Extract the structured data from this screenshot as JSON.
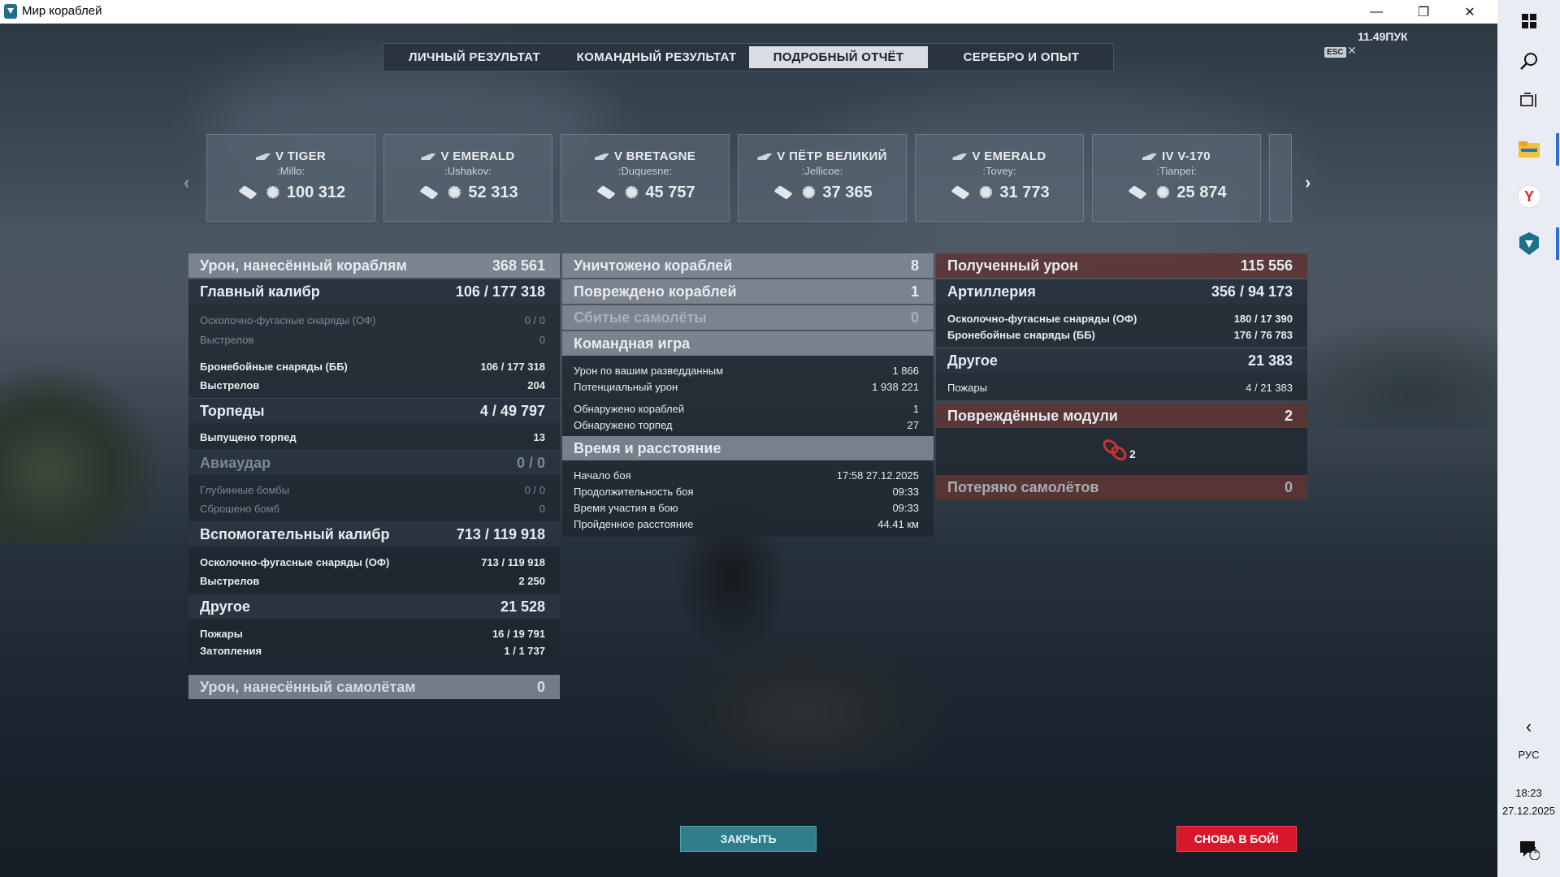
{
  "window": {
    "title": "Мир кораблей",
    "controls": {
      "minimize": "—",
      "maximize": "❐",
      "close": "✕"
    }
  },
  "tabs": [
    {
      "label": "ЛИЧНЫЙ РЕЗУЛЬТАТ",
      "active": false
    },
    {
      "label": "КОМАНДНЫЙ РЕЗУЛЬТАТ",
      "active": false
    },
    {
      "label": "ПОДРОБНЫЙ ОТЧЁТ",
      "active": true
    },
    {
      "label": "СЕРЕБРО И ОПЫТ",
      "active": false
    }
  ],
  "hud": {
    "fps": "11.49ПУК",
    "esc": "ESC",
    "esc_close": "✕"
  },
  "carousel": {
    "prev": "‹",
    "next": "›",
    "cards": [
      {
        "tier_name": "V TIGER",
        "player": ":Millo:",
        "damage": "100 312"
      },
      {
        "tier_name": "V EMERALD",
        "player": ":Ushakov:",
        "damage": "52 313"
      },
      {
        "tier_name": "V BRETAGNE",
        "player": ":Duquesne:",
        "damage": "45 757"
      },
      {
        "tier_name": "V ПЁТР ВЕЛИКИЙ",
        "player": ":Jellicoe:",
        "damage": "37 365"
      },
      {
        "tier_name": "V EMERALD",
        "player": ":Tovey:",
        "damage": "31 773"
      },
      {
        "tier_name": "IV V-170",
        "player": ":Tianpei:",
        "damage": "25 874"
      }
    ]
  },
  "left": {
    "damage_header": {
      "label": "Урон, нанесённый кораблям",
      "value": "368 561"
    },
    "main": {
      "label": "Главный калибр",
      "value": "106 / 177 318"
    },
    "main_he": {
      "label": "Осколочно-фугасные снаряды (ОФ)",
      "value": "0 / 0"
    },
    "main_he_shots": {
      "label": "Выстрелов",
      "value": "0"
    },
    "main_ap": {
      "label": "Бронебойные снаряды (ББ)",
      "value": "106 / 177 318"
    },
    "main_ap_shots": {
      "label": "Выстрелов",
      "value": "204"
    },
    "torp": {
      "label": "Торпеды",
      "value": "4 / 49 797"
    },
    "torp_launched": {
      "label": "Выпущено торпед",
      "value": "13"
    },
    "air": {
      "label": "Авиаудар",
      "value": "0 / 0"
    },
    "depth": {
      "label": "Глубинные бомбы",
      "value": "0 / 0"
    },
    "bombs": {
      "label": "Сброшено бомб",
      "value": "0"
    },
    "sec": {
      "label": "Вспомогательный калибр",
      "value": "713 / 119 918"
    },
    "sec_he": {
      "label": "Осколочно-фугасные снаряды (ОФ)",
      "value": "713 / 119 918"
    },
    "sec_shots": {
      "label": "Выстрелов",
      "value": "2 250"
    },
    "other": {
      "label": "Другое",
      "value": "21 528"
    },
    "fires": {
      "label": "Пожары",
      "value": "16 / 19 791"
    },
    "floods": {
      "label": "Затопления",
      "value": "1 / 1 737"
    },
    "planes": {
      "label": "Урон, нанесённый самолётам",
      "value": "0"
    }
  },
  "middle": {
    "destroyed": {
      "label": "Уничтожено кораблей",
      "value": "8"
    },
    "damaged": {
      "label": "Повреждено кораблей",
      "value": "1"
    },
    "planes_shot": {
      "label": "Сбитые самолёты",
      "value": "0"
    },
    "team": {
      "label": "Командная игра"
    },
    "spotting_dmg": {
      "label": "Урон по вашим разведданным",
      "value": "1 866"
    },
    "potential": {
      "label": "Потенциальный урон",
      "value": "1 938 221"
    },
    "ships_spotted": {
      "label": "Обнаружено кораблей",
      "value": "1"
    },
    "torps_spotted": {
      "label": "Обнаружено торпед",
      "value": "27"
    },
    "time": {
      "label": "Время и расстояние"
    },
    "start": {
      "label": "Начало боя",
      "value": "17:58  27.12.2025"
    },
    "duration": {
      "label": "Продолжительность боя",
      "value": "09:33"
    },
    "participation": {
      "label": "Время участия в бою",
      "value": "09:33"
    },
    "distance": {
      "label": "Пройденное расстояние",
      "value": "44.41 км"
    }
  },
  "right": {
    "received": {
      "label": "Полученный урон",
      "value": "115 556"
    },
    "artillery": {
      "label": "Артиллерия",
      "value": "356 / 94 173"
    },
    "he": {
      "label": "Осколочно-фугасные снаряды (ОФ)",
      "value": "180 / 17 390"
    },
    "ap": {
      "label": "Бронебойные снаряды (ББ)",
      "value": "176 / 76 783"
    },
    "other": {
      "label": "Другое",
      "value": "21 383"
    },
    "fires": {
      "label": "Пожары",
      "value": "4 / 21 383"
    },
    "modules": {
      "label": "Повреждённые модули",
      "value": "2"
    },
    "module_count": "2",
    "planes_lost": {
      "label": "Потеряно самолётов",
      "value": "0"
    }
  },
  "buttons": {
    "close": "ЗАКРЫТЬ",
    "battle": "СНОВА В БОЙ!"
  },
  "taskbar": {
    "lang": "РУС",
    "time": "18:23",
    "date": "27.12.2025",
    "notif_count": "1",
    "chevron": "‹"
  },
  "colors": {
    "accent_close": "#2e7e8c",
    "accent_battle": "#d9162c",
    "damage_received_bg": "#5f3432"
  }
}
